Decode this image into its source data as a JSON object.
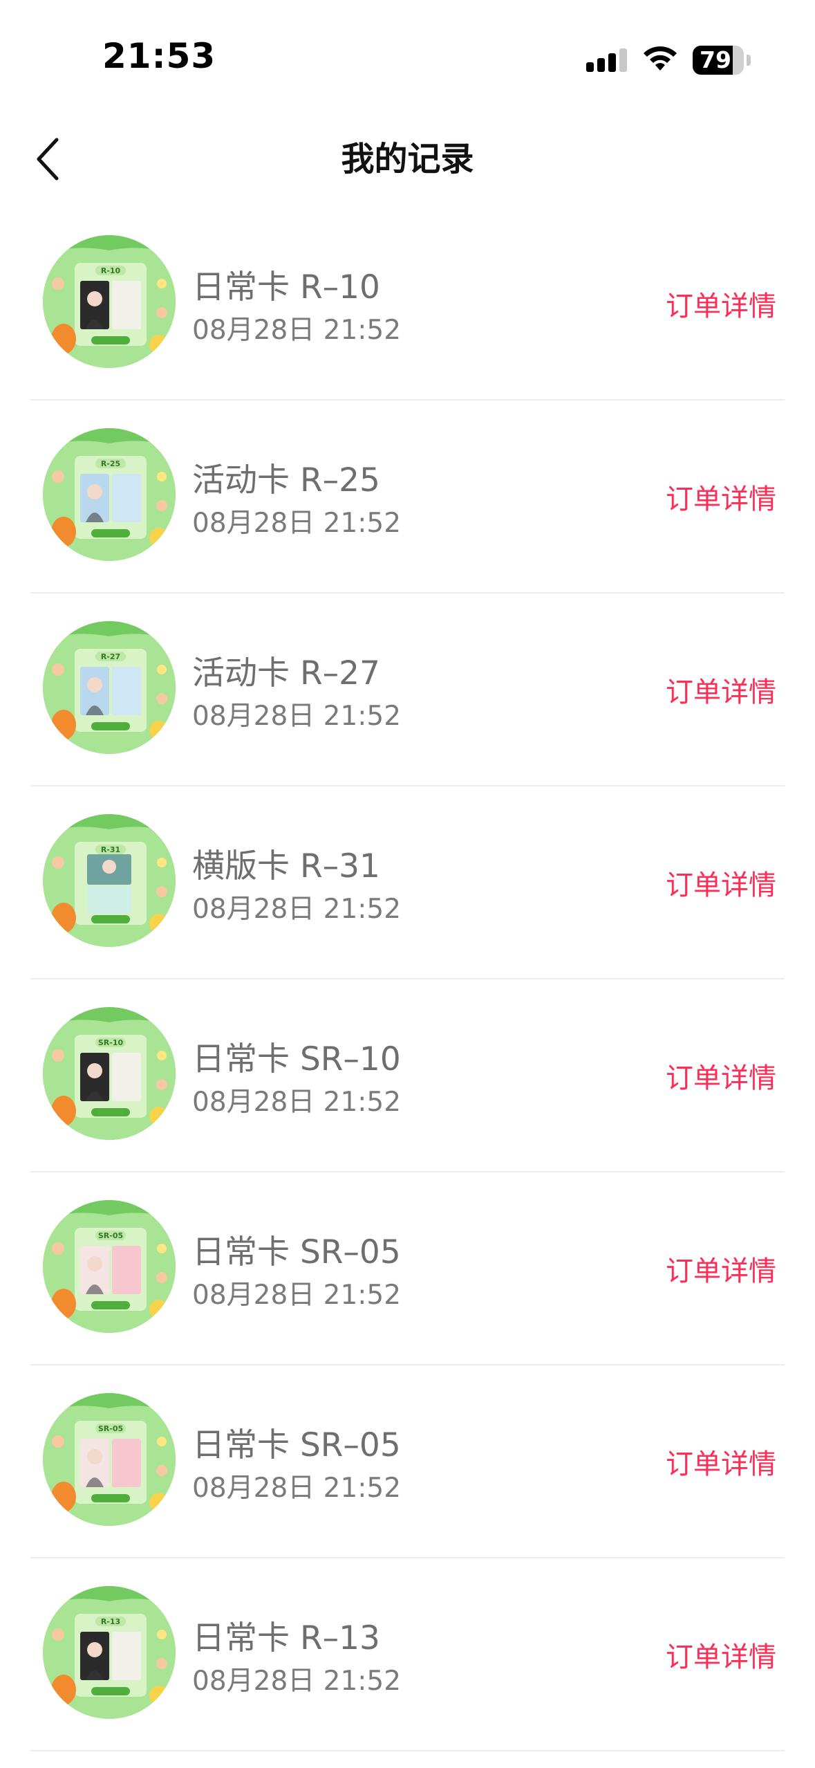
{
  "status_bar": {
    "time": "21:53",
    "battery": "79",
    "battery_level": 0.79,
    "icons": [
      "cellular-signal-icon",
      "wifi-icon",
      "battery-icon"
    ]
  },
  "nav": {
    "back_icon": "chevron-left-icon",
    "title": "我的记录"
  },
  "colors": {
    "accent": "#ff2d55",
    "name_text": "#6e6e6e",
    "time_text": "#7a7a7a",
    "divider": "#ececec",
    "thumb_bg": "#9fe08a"
  },
  "records": [
    {
      "name": "日常卡 R–10",
      "time": "08月28日 21:52",
      "action": "订单详情",
      "badge": "R-10",
      "layout": "pair-dark-light"
    },
    {
      "name": "活动卡 R–25",
      "time": "08月28日 21:52",
      "action": "订单详情",
      "badge": "R-25",
      "layout": "pair-blue"
    },
    {
      "name": "活动卡 R–27",
      "time": "08月28日 21:52",
      "action": "订单详情",
      "badge": "R-27",
      "layout": "pair-blue"
    },
    {
      "name": "横版卡 R–31",
      "time": "08月28日 21:52",
      "action": "订单详情",
      "badge": "R-31",
      "layout": "stack-horizontal"
    },
    {
      "name": "日常卡 SR–10",
      "time": "08月28日 21:52",
      "action": "订单详情",
      "badge": "SR-10",
      "layout": "pair-dark-light"
    },
    {
      "name": "日常卡 SR–05",
      "time": "08月28日 21:52",
      "action": "订单详情",
      "badge": "SR-05",
      "layout": "pair-pink"
    },
    {
      "name": "日常卡 SR–05",
      "time": "08月28日 21:52",
      "action": "订单详情",
      "badge": "SR-05",
      "layout": "pair-pink"
    },
    {
      "name": "日常卡 R–13",
      "time": "08月28日 21:52",
      "action": "订单详情",
      "badge": "R-13",
      "layout": "pair-dark-light"
    }
  ]
}
